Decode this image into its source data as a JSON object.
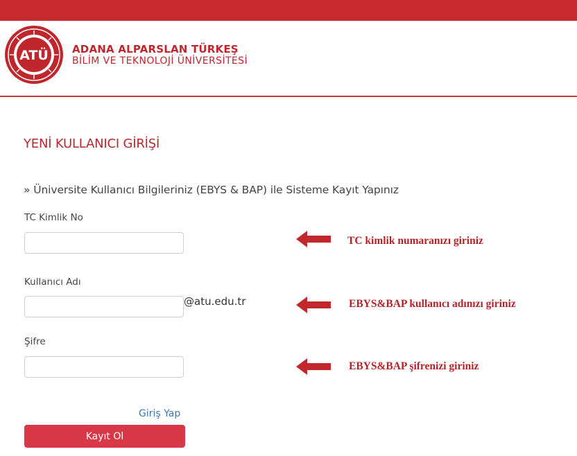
{
  "header": {
    "logo_text": "ATÜ",
    "name_line1": "ADANA ALPARSLAN TÜRKEŞ",
    "name_line2": "BİLİM VE TEKNOLOJİ ÜNİVERSİTESİ"
  },
  "page": {
    "title": "YENİ KULLANICI GİRİŞİ",
    "subtitle": "» Üniversite Kullanıcı Bilgileriniz (EBYS & BAP) ile Sisteme Kayıt Yapınız"
  },
  "form": {
    "tc": {
      "label": "TC Kimlik No",
      "value": ""
    },
    "username": {
      "label": "Kullanıcı Adı",
      "value": "",
      "suffix": "@atu.edu.tr"
    },
    "password": {
      "label": "Şifre",
      "value": ""
    },
    "login_link": "Giriş Yap",
    "register_button": "Kayıt Ol"
  },
  "annotations": [
    "TC kimlik numaranızı giriniz",
    "EBYS&BAP kullanıcı adınızı giriniz",
    "EBYS&BAP şifrenizi giriniz"
  ],
  "colors": {
    "top_bar": "#c62a2c",
    "brand_red": "#c0272d",
    "title_red": "#b52a2f",
    "button_red": "#d93848",
    "arrow_red": "#c0282c",
    "link_blue": "#3a7ab7"
  },
  "icons": {
    "logo": "university-seal-icon",
    "arrow": "arrow-left-icon"
  }
}
